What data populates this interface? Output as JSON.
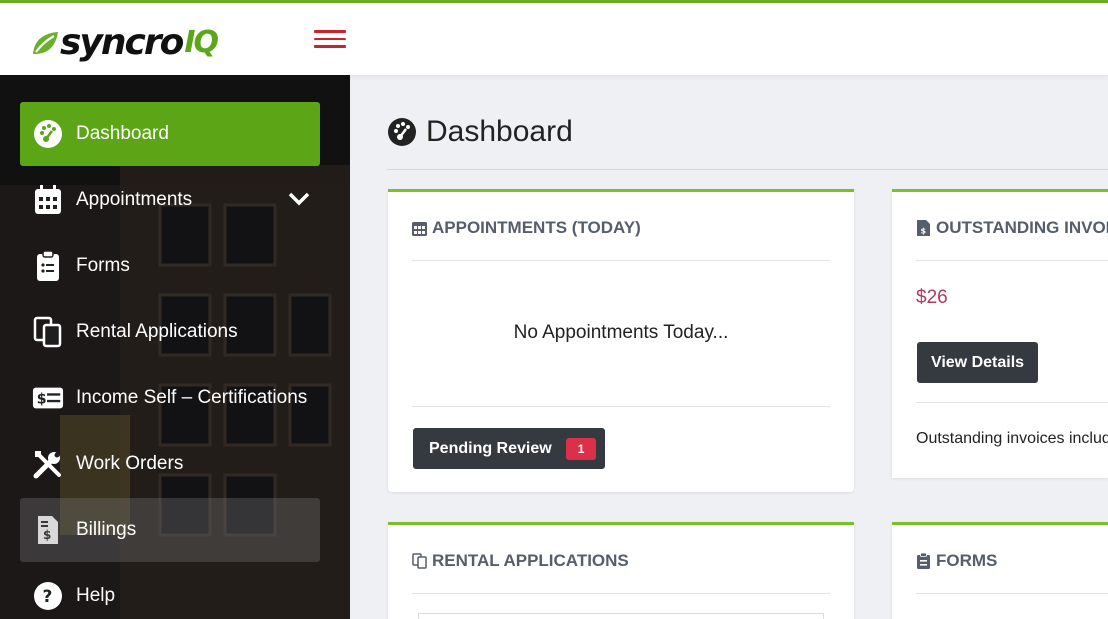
{
  "brand": {
    "name": "syncro",
    "suffix": "IQ",
    "accent": "#5ca517",
    "top_border": "#6aad1e",
    "menu_color": "#c8232c"
  },
  "sidebar": {
    "items": [
      {
        "label": "Dashboard",
        "icon": "tachometer-icon",
        "active": true
      },
      {
        "label": "Appointments",
        "icon": "calendar-icon",
        "expandable": true
      },
      {
        "label": "Forms",
        "icon": "clipboard-list-icon"
      },
      {
        "label": "Rental Applications",
        "icon": "copy-icon"
      },
      {
        "label": "Income Self – Certifications",
        "icon": "money-bill-icon"
      },
      {
        "label": "Work Orders",
        "icon": "tools-icon"
      },
      {
        "label": "Billings",
        "icon": "file-invoice-dollar-icon",
        "highlighted": true
      },
      {
        "label": "Help",
        "icon": "question-circle-icon"
      }
    ]
  },
  "main": {
    "title": "Dashboard",
    "cards": {
      "appointments": {
        "title": "APPOINTMENTS (TODAY)",
        "empty_message": "No Appointments Today...",
        "pending_label": "Pending Review",
        "pending_count": "1"
      },
      "invoices": {
        "title": "OUTSTANDING INVOICES",
        "amount": "$26",
        "button_label": "View Details",
        "note": "Outstanding invoices include"
      },
      "rental": {
        "title": "RENTAL APPLICATIONS"
      },
      "forms": {
        "title": "FORMS"
      }
    }
  }
}
